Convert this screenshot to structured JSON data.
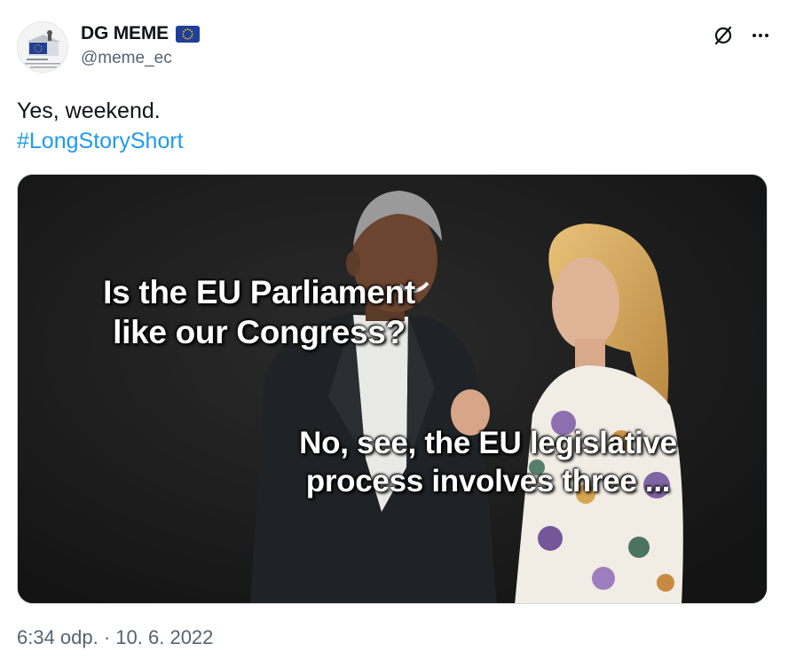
{
  "tweet": {
    "author": {
      "display_name": "DG MEME",
      "handle": "@meme_ec",
      "badge_icon": "eu-flag-icon",
      "avatar_icon": "dg-meme-logo-icon"
    },
    "actions": {
      "grok_icon": "slashed-circle-icon",
      "more_icon": "more-dots-icon",
      "more_label": "···"
    },
    "text": "Yes, weekend.",
    "hashtag": "#LongStoryShort",
    "media": {
      "top_caption_line1": "Is the EU Parliament",
      "top_caption_line2": "like our Congress?",
      "bottom_caption_line1": "No, see, the EU legislative",
      "bottom_caption_line2": "process involves three ..."
    },
    "timestamp": "6:34 odp. · 10. 6. 2022"
  },
  "colors": {
    "link": "#1d9bf0",
    "secondary_text": "#536471",
    "eu_blue": "#1f3f9a",
    "eu_star": "#ffcc00"
  }
}
